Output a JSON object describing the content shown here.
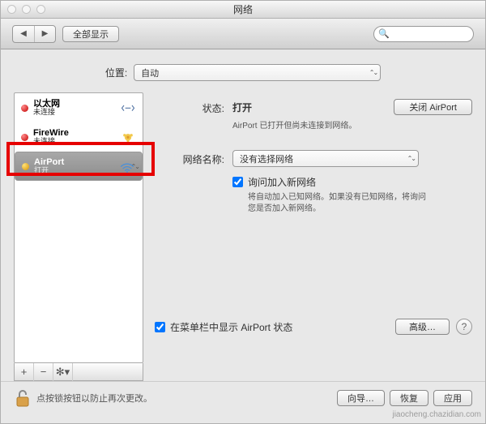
{
  "titlebar": {
    "title": "网络"
  },
  "toolbar": {
    "show_all": "全部显示",
    "search_placeholder": ""
  },
  "location": {
    "label": "位置:",
    "value": "自动"
  },
  "sidebar": {
    "items": [
      {
        "name": "以太网",
        "status": "未连接",
        "dot": "red"
      },
      {
        "name": "FireWire",
        "status": "未连接",
        "dot": "red"
      },
      {
        "name": "AirPort",
        "status": "打开",
        "dot": "yel"
      }
    ],
    "add": "+",
    "remove": "−",
    "gear": "✻▾"
  },
  "content": {
    "status_label": "状态:",
    "status_value": "打开",
    "close_btn": "关闭 AirPort",
    "status_desc": "AirPort 已打开但尚未连接到网络。",
    "netname_label": "网络名称:",
    "netname_value": "没有选择网络",
    "ask_join": "询问加入新网络",
    "ask_desc": "将自动加入已知网络。如果没有已知网络，将询问您是否加入新网络。",
    "menubar_label": "在菜单栏中显示 AirPort 状态",
    "advanced": "高级…"
  },
  "footer": {
    "lock_text": "点按锁按钮以防止再次更改。",
    "assist": "向导…",
    "revert": "恢复",
    "apply": "应用"
  },
  "watermark": "jiaocheng.chazidian.com"
}
